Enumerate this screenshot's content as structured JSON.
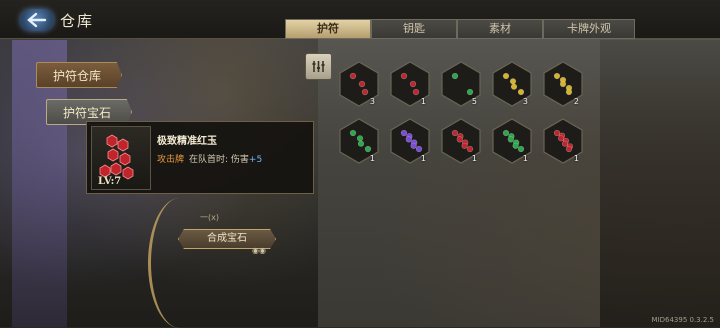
{
  "header": {
    "title": "仓库",
    "tabs": [
      {
        "label": "护符",
        "active": true
      },
      {
        "label": "钥匙",
        "active": false
      },
      {
        "label": "素材",
        "active": false
      },
      {
        "label": "卡牌外观",
        "active": false
      }
    ]
  },
  "sidebar": {
    "items": [
      {
        "label": "护符仓库"
      },
      {
        "label": "护符宝石"
      }
    ]
  },
  "tooltip": {
    "level": "LV:7",
    "name": "极致精准红玉",
    "type_label": "攻击牌",
    "effect_text": "在队首时: 伤害",
    "effect_value": "+5"
  },
  "synthesize": {
    "label": "合成宝石",
    "top_label": "一(x)"
  },
  "grid": {
    "items": [
      {
        "name": "red-gem",
        "color": "#c0242c",
        "count": "3",
        "dots": 3
      },
      {
        "name": "red-gem",
        "color": "#c0242c",
        "count": "1",
        "dots": 3
      },
      {
        "name": "green-gem",
        "color": "#2aa84a",
        "count": "5",
        "dots": 2
      },
      {
        "name": "yellow-gem",
        "color": "#d4b22a",
        "count": "3",
        "dots": 4
      },
      {
        "name": "yellow-gem",
        "color": "#d4b22a",
        "count": "2",
        "dots": 5
      },
      {
        "name": "green-gem",
        "color": "#2aa84a",
        "count": "1",
        "dots": 4
      },
      {
        "name": "purple-gem",
        "color": "#7a4ad8",
        "count": "1",
        "dots": 6
      },
      {
        "name": "red-gem",
        "color": "#c0242c",
        "count": "1",
        "dots": 6
      },
      {
        "name": "green-gem",
        "color": "#2aa84a",
        "count": "1",
        "dots": 6
      },
      {
        "name": "red-gem",
        "color": "#c0242c",
        "count": "1",
        "dots": 7
      }
    ]
  },
  "footer": {
    "version": "MID64395 0.3.2.5"
  }
}
